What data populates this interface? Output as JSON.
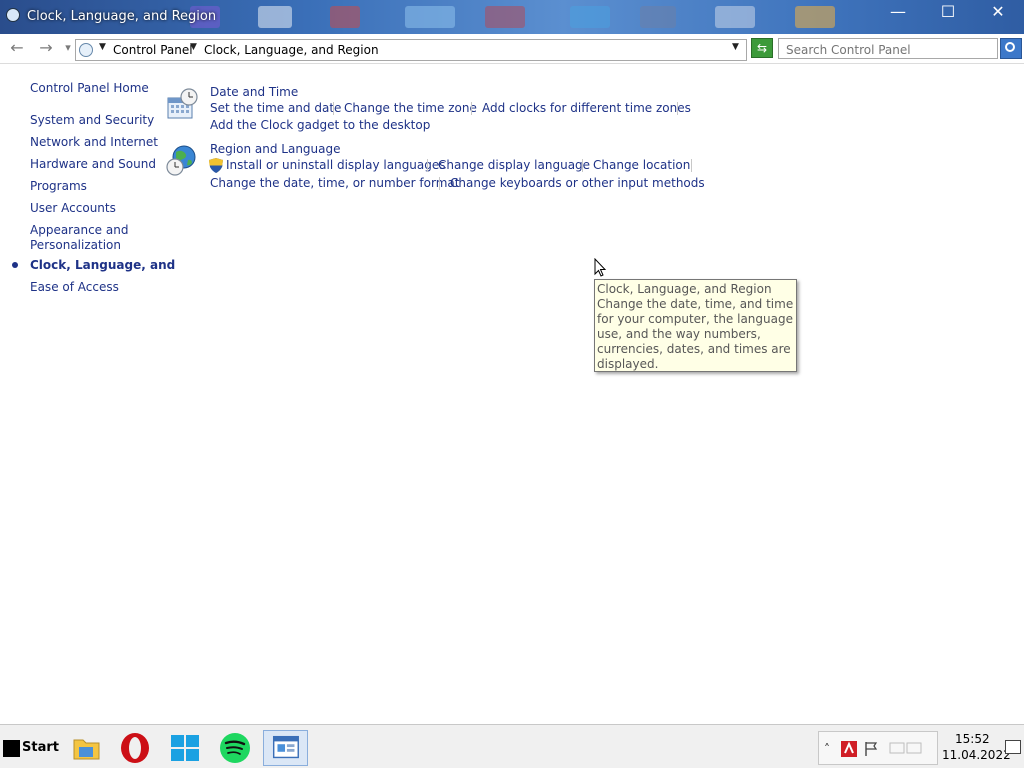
{
  "window": {
    "title": "Clock, Language, and Region",
    "minimize_glyph": "—",
    "maximize_glyph": "☐",
    "close_glyph": "✕"
  },
  "address": {
    "back_glyph": "←",
    "forward_glyph": "→",
    "recent_glyph": "▾",
    "crumbs": [
      "Control Panel",
      "Clock, Language, and Region"
    ],
    "dropdown_glyph": "▼",
    "refresh_glyph": "⇆",
    "search_placeholder": "Search Control Panel"
  },
  "sidebar": {
    "home": "Control Panel Home",
    "items": [
      "System and Security",
      "Network and Internet",
      "Hardware and Sound",
      "Programs",
      "User Accounts",
      "Appearance and",
      "Personalization",
      "Clock, Language, and",
      "Ease of Access"
    ]
  },
  "main": {
    "categories": [
      {
        "title": "Date and Time",
        "icon": "calendar-clock-icon",
        "tasks": [
          "Set the time and date",
          "Change the time zone",
          "Add clocks for different time zones",
          "Add the Clock gadget to the desktop"
        ]
      },
      {
        "title": "Region and Language",
        "icon": "globe-clock-icon",
        "tasks": [
          "Install or uninstall display languages",
          "Change display language",
          "Change location",
          "Change the date, time, or number format",
          "Change keyboards or other input methods"
        ]
      }
    ]
  },
  "tooltip": {
    "lines": [
      "Clock, Language, and Region",
      "Change the date, time, and time zone",
      "for your computer, the language to",
      "use, and the way numbers,",
      "currencies, dates, and times are",
      "displayed."
    ]
  },
  "taskbar": {
    "start_label": "Start",
    "apps": [
      "file-explorer-icon",
      "opera-icon",
      "windows-store-icon",
      "spotify-icon",
      "control-panel-icon"
    ],
    "tray_expand_glyph": "˄",
    "time": "15:52",
    "date": "11.04.2022",
    "colors": {
      "opera": "#cc0f16",
      "spotify": "#1ed760",
      "windows": "#1ba1e2",
      "folder": "#f4c542"
    }
  }
}
